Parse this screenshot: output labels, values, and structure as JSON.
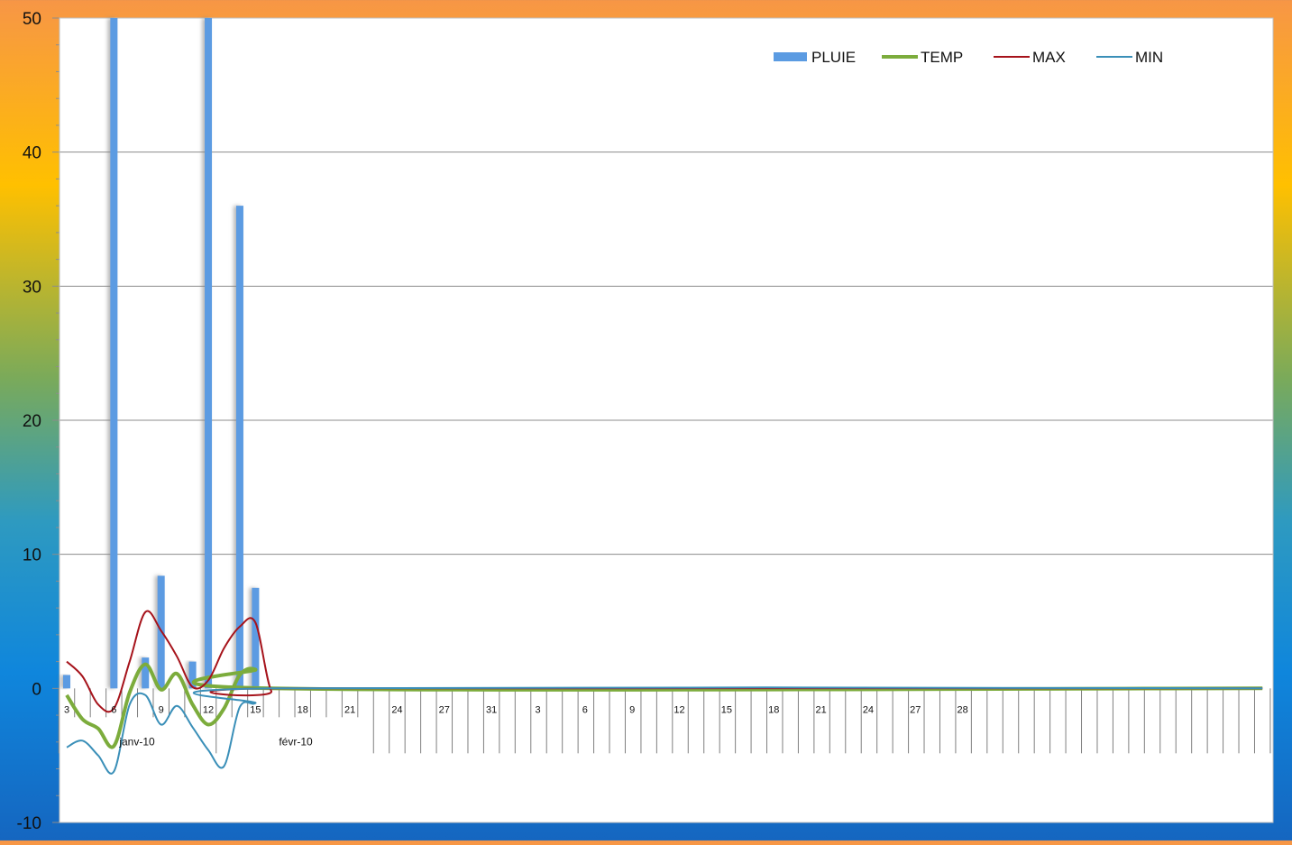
{
  "chart_data": {
    "type": "bar",
    "title": "",
    "xlabel": "",
    "ylabel": "",
    "ylim": [
      -10,
      50
    ],
    "yticks": [
      "50",
      "40",
      "30",
      "20",
      "10",
      "0",
      "-10"
    ],
    "grid": true,
    "legend_position": "top-right",
    "x_tick_labels": [
      "3",
      "6",
      "9",
      "12",
      "15",
      "18",
      "21",
      "24",
      "27",
      "31",
      "3",
      "6",
      "9",
      "12",
      "15",
      "18",
      "21",
      "24",
      "27",
      "28"
    ],
    "group_labels": [
      "janv-10",
      "févr-10"
    ],
    "x_days": [
      1,
      2,
      3,
      4,
      5,
      6,
      7,
      8,
      9,
      10,
      11,
      12,
      13,
      14,
      15,
      16,
      17,
      18,
      19,
      20,
      21,
      22,
      23,
      24,
      25,
      26,
      27,
      28,
      29,
      30,
      31,
      32,
      33,
      34,
      35,
      36,
      37,
      38,
      39,
      40,
      41,
      42,
      43,
      44,
      45,
      46,
      47,
      48,
      49,
      50,
      51,
      52,
      53,
      54,
      55,
      56,
      57,
      58,
      59,
      60,
      61,
      62,
      63,
      64,
      65,
      66,
      67,
      68,
      69,
      70,
      71,
      72,
      73,
      74,
      75,
      76,
      77
    ],
    "series": [
      {
        "name": "PLUIE",
        "type": "bar",
        "color": "#5b9be2",
        "values": [
          {
            "day": 1,
            "v": 1
          },
          {
            "day": 4,
            "v": 50
          },
          {
            "day": 6,
            "v": 2.3
          },
          {
            "day": 7,
            "v": 8.4
          },
          {
            "day": 9,
            "v": 2
          },
          {
            "day": 10,
            "v": 50
          },
          {
            "day": 12,
            "v": 36
          },
          {
            "day": 13,
            "v": 7.5
          }
        ]
      },
      {
        "name": "TEMP",
        "type": "line",
        "color": "#7cac3c",
        "values": [
          {
            "day": 1,
            "v": -0.5
          },
          {
            "day": 2,
            "v": -2.3
          },
          {
            "day": 3,
            "v": -3
          },
          {
            "day": 4,
            "v": -4.3
          },
          {
            "day": 5,
            "v": -0.3
          },
          {
            "day": 6,
            "v": 1.8
          },
          {
            "day": 7,
            "v": -0.1
          },
          {
            "day": 8,
            "v": 1.1
          },
          {
            "day": 9,
            "v": -1.2
          },
          {
            "day": 10,
            "v": -2.7
          },
          {
            "day": 11,
            "v": -1.5
          },
          {
            "day": 12,
            "v": 1
          },
          {
            "day": 13,
            "v": 1.4
          },
          {
            "day": 14,
            "v": 0
          },
          {
            "day": 77,
            "v": 0
          }
        ]
      },
      {
        "name": "MAX",
        "type": "line",
        "color": "#a6131b",
        "values": [
          {
            "day": 1,
            "v": 2
          },
          {
            "day": 2,
            "v": 0.9
          },
          {
            "day": 3,
            "v": -1.2
          },
          {
            "day": 4,
            "v": -1.5
          },
          {
            "day": 5,
            "v": 2
          },
          {
            "day": 6,
            "v": 5.7
          },
          {
            "day": 7,
            "v": 4.3
          },
          {
            "day": 8,
            "v": 2.4
          },
          {
            "day": 9,
            "v": 0.1
          },
          {
            "day": 10,
            "v": 0.6
          },
          {
            "day": 11,
            "v": 3
          },
          {
            "day": 12,
            "v": 4.6
          },
          {
            "day": 13,
            "v": 4.9
          },
          {
            "day": 14,
            "v": -0.2
          },
          {
            "day": 15,
            "v": 0
          },
          {
            "day": 77,
            "v": 0
          }
        ]
      },
      {
        "name": "MIN",
        "type": "line",
        "color": "#3a8fb8",
        "values": [
          {
            "day": 1,
            "v": -4.4
          },
          {
            "day": 2,
            "v": -3.9
          },
          {
            "day": 3,
            "v": -5
          },
          {
            "day": 4,
            "v": -6.2
          },
          {
            "day": 5,
            "v": -1.2
          },
          {
            "day": 6,
            "v": -0.5
          },
          {
            "day": 7,
            "v": -2.7
          },
          {
            "day": 8,
            "v": -1.3
          },
          {
            "day": 9,
            "v": -2.9
          },
          {
            "day": 10,
            "v": -4.6
          },
          {
            "day": 11,
            "v": -5.8
          },
          {
            "day": 12,
            "v": -1.4
          },
          {
            "day": 13,
            "v": -1.1
          },
          {
            "day": 14,
            "v": 0
          },
          {
            "day": 77,
            "v": 0
          }
        ]
      }
    ]
  }
}
